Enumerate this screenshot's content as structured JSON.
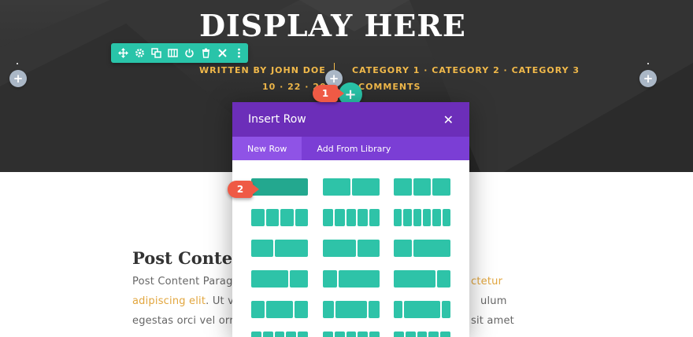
{
  "hero": {
    "title": "DISPLAY HERE",
    "author": "WRITTEN BY JOHN DOE",
    "categories": "CATEGORY 1 · CATEGORY 2 · CATEGORY 3",
    "date": "10 · 22 · 20",
    "comments": "COMMENTS"
  },
  "toolbar": {
    "icons": [
      "move-icon",
      "gear-icon",
      "duplicate-icon",
      "columns-icon",
      "power-icon",
      "trash-icon",
      "close-icon",
      "more-icon"
    ]
  },
  "add_buttons": {
    "plus": "+"
  },
  "callouts": {
    "one": "1",
    "two": "2"
  },
  "modal": {
    "title": "Insert Row",
    "close": "✕",
    "tabs": [
      "New Row",
      "Add From Library"
    ],
    "active_tab": "New Row",
    "layouts": [
      [
        [
          1
        ]
      ],
      [
        [
          1,
          1
        ]
      ],
      [
        [
          1,
          1,
          1
        ]
      ],
      [
        [
          1,
          1,
          1,
          1
        ]
      ],
      [
        [
          1,
          1,
          1,
          1,
          1
        ]
      ],
      [
        [
          1,
          1,
          1,
          1,
          1,
          1
        ]
      ],
      [
        [
          2,
          3
        ]
      ],
      [
        [
          3,
          2
        ]
      ],
      [
        [
          1,
          2
        ]
      ],
      [
        [
          2,
          1
        ]
      ],
      [
        [
          1,
          3
        ]
      ],
      [
        [
          3,
          1
        ]
      ],
      [
        [
          1,
          2,
          1
        ]
      ],
      [
        [
          1,
          3,
          1
        ]
      ],
      [
        [
          1,
          4,
          1
        ]
      ],
      [
        [
          1,
          1,
          1,
          1,
          1
        ]
      ],
      [
        [
          1,
          1,
          1,
          1,
          1
        ]
      ],
      [
        [
          1,
          1,
          1,
          1,
          1
        ]
      ]
    ]
  },
  "content": {
    "heading": "Post Conte",
    "line1_left": "Post Content Parag",
    "line1_right": "ctetur",
    "line2_link": "adipiscing elit",
    "line2_left_rest": ". Ut v",
    "line2_right": "ulum",
    "line3_left": "egestas orci vel orr",
    "line3_right": "sit amet",
    "line4_left": ""
  },
  "colors": {
    "accent_green": "#29c4a9",
    "purple_header": "#6c2eb9",
    "purple_tabs": "#7b3ed5",
    "gold": "#f1b94a",
    "badge_red": "#ef5a45"
  }
}
